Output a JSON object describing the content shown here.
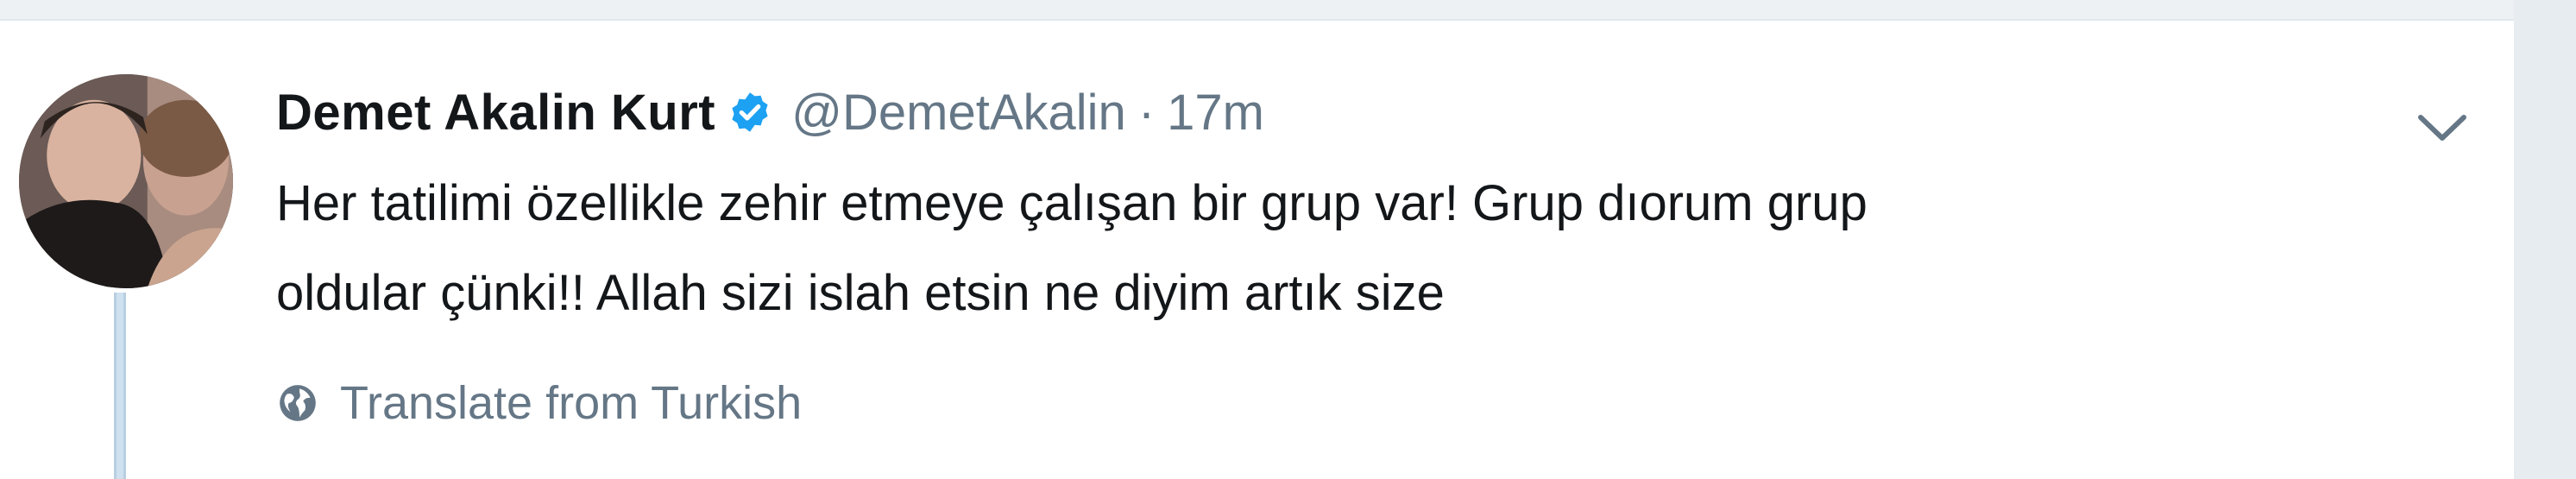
{
  "tweet": {
    "display_name": "Demet Akalin Kurt",
    "handle": "@DemetAkalin",
    "separator": "·",
    "timestamp": "17m",
    "text_lines": [
      "Her tatilimi özellikle zehir etmeye çalışan bir grup var! Grup dıorum grup",
      "oldular çünki!! Allah sizi islah etsin ne diyim artık size"
    ],
    "translate_label": "Translate from Turkish"
  },
  "icons": {
    "verified": "verified-badge-icon",
    "menu": "chevron-down-icon",
    "translate": "globe-icon"
  },
  "colors": {
    "primary_text": "#14171a",
    "secondary_text": "#657786",
    "verified_blue": "#1da1f2",
    "background": "#e6ecf0",
    "card": "#ffffff"
  }
}
